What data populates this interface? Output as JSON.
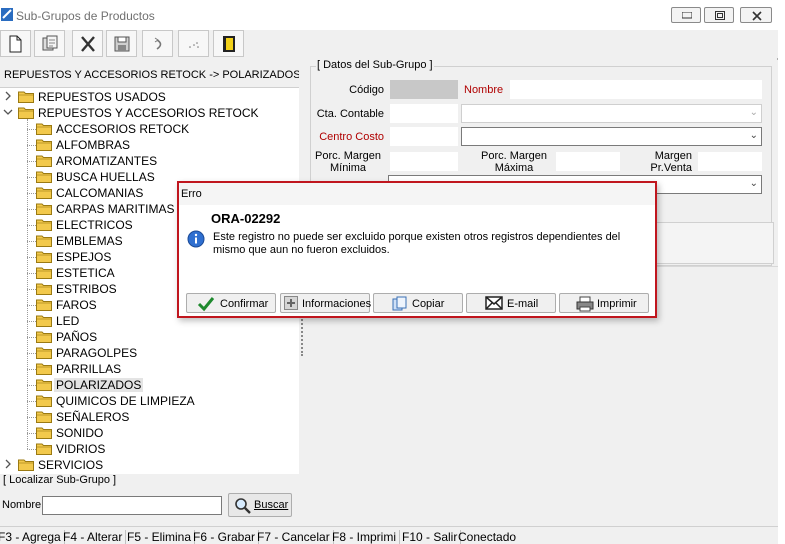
{
  "window": {
    "title": "Sub-Grupos de Productos",
    "controls": {
      "minimize": "▭",
      "maximize": "□",
      "close": "✕"
    }
  },
  "toolbar": {
    "buttons": [
      {
        "icon": "new-document-icon"
      },
      {
        "icon": "copy-record-icon"
      },
      {
        "icon": "delete-icon"
      },
      {
        "icon": "save-icon"
      },
      {
        "icon": "undo-icon"
      },
      {
        "icon": "refresh-icon"
      },
      {
        "icon": "exit-door-icon"
      }
    ]
  },
  "left": {
    "breadcrumb": "REPUESTOS Y ACCESORIOS RETOCK -> POLARIZADOS",
    "tree": {
      "items": [
        {
          "label": "REPUESTOS USADOS",
          "level": 0,
          "expander": "›"
        },
        {
          "label": "REPUESTOS Y ACCESORIOS RETOCK",
          "level": 0,
          "expander": "⌄"
        },
        {
          "label": "ACCESORIOS RETOCK",
          "level": 1
        },
        {
          "label": "ALFOMBRAS",
          "level": 1
        },
        {
          "label": "AROMATIZANTES",
          "level": 1
        },
        {
          "label": "BUSCA HUELLAS",
          "level": 1
        },
        {
          "label": "CALCOMANIAS",
          "level": 1
        },
        {
          "label": "CARPAS MARITIMAS",
          "level": 1
        },
        {
          "label": "ELECTRICOS",
          "level": 1
        },
        {
          "label": "EMBLEMAS",
          "level": 1
        },
        {
          "label": "ESPEJOS",
          "level": 1
        },
        {
          "label": "ESTETICA",
          "level": 1
        },
        {
          "label": "ESTRIBOS",
          "level": 1
        },
        {
          "label": "FAROS",
          "level": 1
        },
        {
          "label": "LED",
          "level": 1
        },
        {
          "label": "PAÑOS",
          "level": 1
        },
        {
          "label": "PARAGOLPES",
          "level": 1
        },
        {
          "label": "PARRILLAS",
          "level": 1
        },
        {
          "label": "POLARIZADOS",
          "level": 1,
          "selected": true
        },
        {
          "label": "QUIMICOS DE LIMPIEZA",
          "level": 1
        },
        {
          "label": "SEÑALEROS",
          "level": 1
        },
        {
          "label": "SONIDO",
          "level": 1
        },
        {
          "label": "VIDRIOS",
          "level": 1
        },
        {
          "label": "SERVICIOS",
          "level": 0,
          "expander": "›"
        }
      ]
    },
    "search": {
      "legend": "[ Localizar Sub-Grupo ]",
      "nombre_label": "Nombre",
      "nombre_value": "",
      "buscar_label": "Buscar"
    }
  },
  "right": {
    "group_legend": "[ Datos del Sub-Grupo ]",
    "codigo_label": "Código",
    "nombre_label": "Nombre",
    "cta_contable_label": "Cta. Contable",
    "centro_costo_label": "Centro Costo",
    "margen_minima_label_1": "Porc. Margen",
    "margen_minima_label_2": "Mínima",
    "margen_maxima_label_1": "Porc. Margen",
    "margen_maxima_label_2": "Máxima",
    "margen_prventa_label_1": "Margen",
    "margen_prventa_label_2": "Pr.Venta",
    "dropdown_arrow": "⌄"
  },
  "statusbar": {
    "items": [
      "F3 - Agrega",
      "F4 - Alterar",
      "F5 - Elimina",
      "F6 - Grabar",
      "F7 - Cancelar",
      "F8 - Imprimi",
      "F10 - Salir",
      "Conectado"
    ]
  },
  "dialog": {
    "title": "Erro",
    "code": "ORA-02292",
    "message": "Este registro no puede ser excluido porque existen otros registros dependientes del mismo que aun no fueron excluidos.",
    "buttons": {
      "confirmar": "Confirmar",
      "informaciones": "Informaciones",
      "copiar": "Copiar",
      "email": "E-mail",
      "imprimir": "Imprimir"
    }
  },
  "colors": {
    "dialog_border": "#c0161e",
    "required_label": "#b00000",
    "folder": "#f2c94c"
  }
}
